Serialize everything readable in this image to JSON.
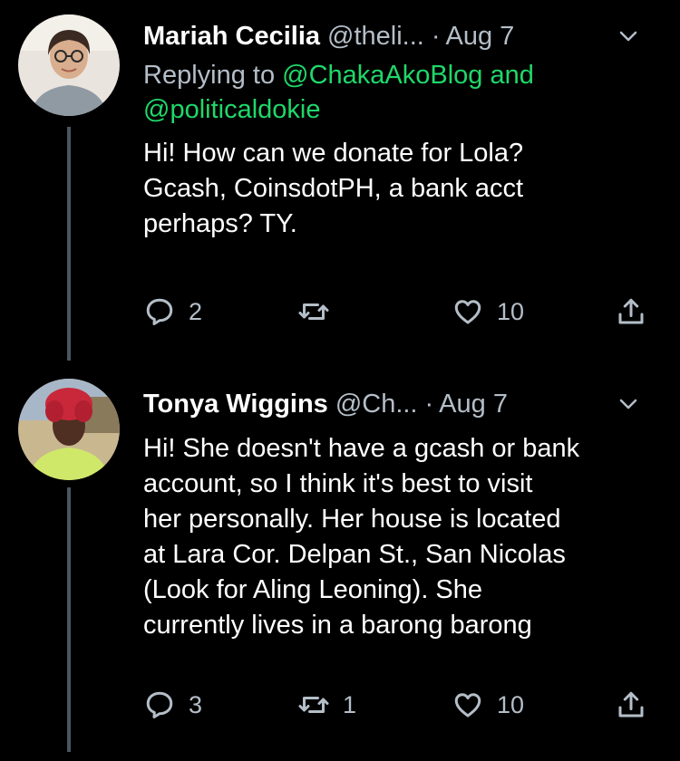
{
  "tweets": [
    {
      "name": "Mariah Cecilia",
      "handle": "@theli...",
      "separator": "·",
      "date": "Aug 7",
      "reply_prefix": "Replying to ",
      "reply_mention_1": "@ChakaAkoBlog",
      "reply_and": " and",
      "reply_mention_2": "@politicaldokie",
      "text": "Hi! How can we donate for Lola?\nGcash, CoinsdotPH, a bank acct\nperhaps? TY.",
      "reply_count": "2",
      "retweet_count": "",
      "like_count": "10"
    },
    {
      "name": "Tonya Wiggins",
      "handle": "@Ch...",
      "separator": "·",
      "date": "Aug 7",
      "text": "Hi! She doesn't have a gcash or bank\naccount, so I think it's best to visit\nher personally. Her house is located\nat Lara Cor. Delpan St., San Nicolas\n(Look for Aling Leoning). She\ncurrently lives in a barong barong",
      "reply_count": "3",
      "retweet_count": "1",
      "like_count": "10"
    }
  ],
  "icons": {
    "more": "chevron-down-icon",
    "reply": "reply-icon",
    "retweet": "retweet-icon",
    "like": "heart-icon",
    "share": "share-icon"
  },
  "colors": {
    "background": "#000000",
    "text": "#ffffff",
    "secondary": "#b4bec8",
    "mention": "#1fd86a",
    "thread_line": "#4a5560"
  }
}
